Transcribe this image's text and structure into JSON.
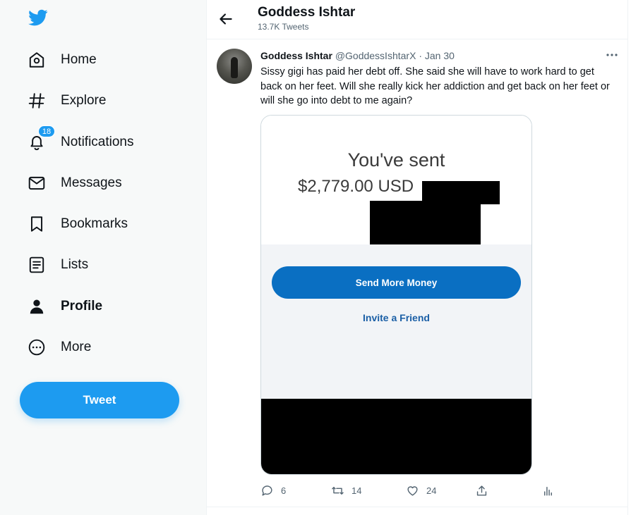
{
  "sidebar": {
    "nav": [
      {
        "label": "Home",
        "icon": "home-icon"
      },
      {
        "label": "Explore",
        "icon": "hashtag-icon"
      },
      {
        "label": "Notifications",
        "icon": "bell-icon",
        "badge": "18"
      },
      {
        "label": "Messages",
        "icon": "envelope-icon"
      },
      {
        "label": "Bookmarks",
        "icon": "bookmark-icon"
      },
      {
        "label": "Lists",
        "icon": "list-icon"
      },
      {
        "label": "Profile",
        "icon": "person-icon",
        "active": true
      },
      {
        "label": "More",
        "icon": "more-circle-icon"
      }
    ],
    "tweet_button": "Tweet"
  },
  "header": {
    "name": "Goddess Ishtar",
    "tweet_count": "13.7K Tweets"
  },
  "tweet": {
    "author_name": "Goddess Ishtar",
    "author_handle": "@GoddessIshtarX",
    "date": "Jan 30",
    "text": "Sissy gigi has paid her debt off. She said she will have to work hard to get back on her feet. Will she really kick her addiction and get back on her feet or will she go into debt to me again?",
    "media": {
      "title": "You've sent",
      "amount": "$2,779.00 USD",
      "button": "Send More Money",
      "link": "Invite a Friend"
    },
    "actions": {
      "replies": "6",
      "retweets": "14",
      "likes": "24"
    }
  },
  "colors": {
    "accent": "#1d9bf0",
    "paypal_button": "#0a6fc2",
    "paypal_link": "#1b5fa6"
  }
}
